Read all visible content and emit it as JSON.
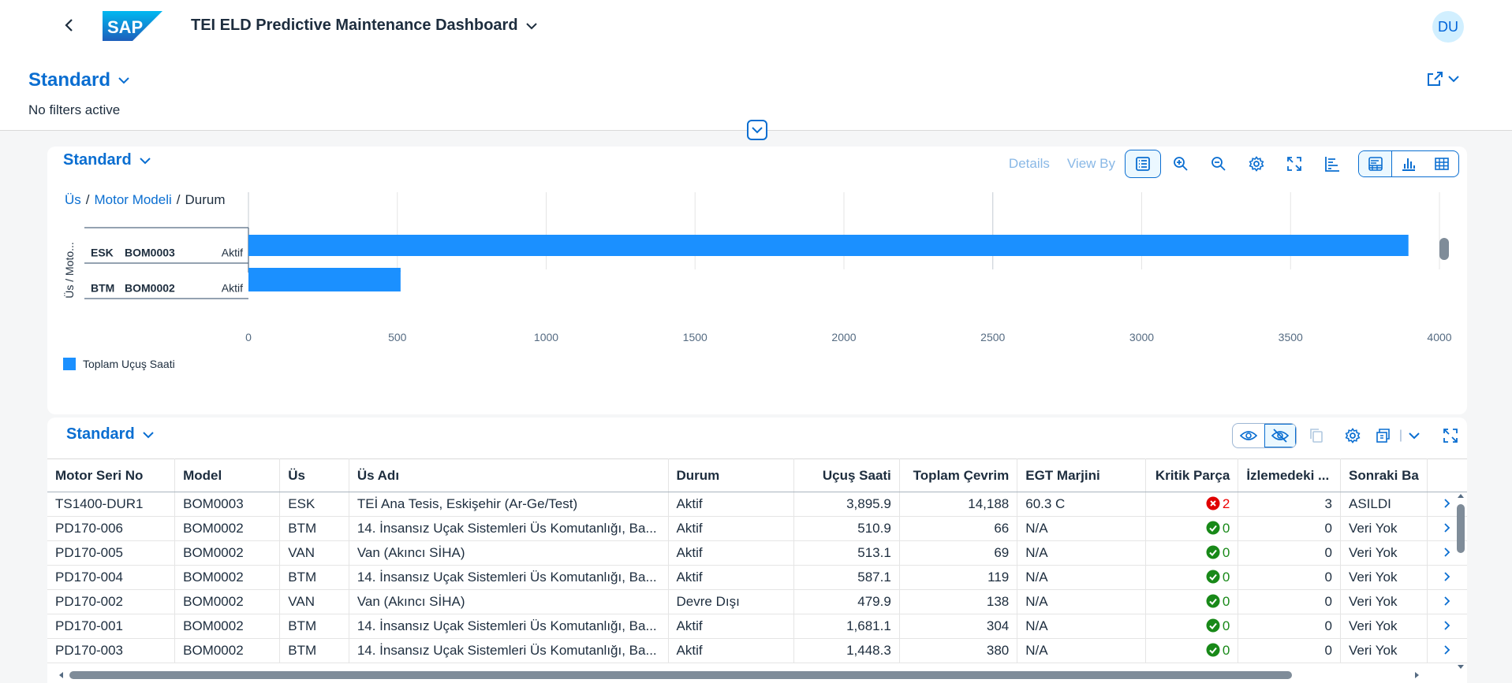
{
  "shell": {
    "title": "TEI ELD Predictive Maintenance Dashboard",
    "logo_text": "SAP",
    "avatar": "DU"
  },
  "header": {
    "variant": "Standard",
    "filters_status": "No filters active"
  },
  "chart_card": {
    "variant": "Standard",
    "toolbar": {
      "details": "Details",
      "view_by": "View By"
    },
    "breadcrumb": [
      "Üs",
      "Motor Modeli",
      "Durum"
    ],
    "y_axis_label": "Üs / Moto..."
  },
  "chart_data": {
    "type": "bar",
    "orientation": "horizontal",
    "categories": [
      {
        "base": "ESK",
        "model": "BOM0003",
        "status": "Aktif"
      },
      {
        "base": "BTM",
        "model": "BOM0002",
        "status": "Aktif"
      }
    ],
    "series": [
      {
        "name": "Toplam Uçuş Saati",
        "values": [
          3895.9,
          510.9
        ],
        "color": "#1b90ff"
      }
    ],
    "x_ticks": [
      "0",
      "500",
      "1000",
      "1500",
      "2000",
      "2500",
      "3000",
      "3500",
      "4000"
    ],
    "xlim": [
      0,
      4000
    ],
    "legend": "Toplam Uçuş Saati",
    "legend_position": "bottom-left",
    "grid": true
  },
  "table_card": {
    "variant": "Standard",
    "columns": [
      "Motor Seri No",
      "Model",
      "Üs",
      "Üs Adı",
      "Durum",
      "Uçuş Saati",
      "Toplam Çevrim",
      "EGT Marjini",
      "Kritik Parça",
      "İzlemedeki ...",
      "Sonraki Ba"
    ],
    "rows": [
      {
        "serial": "TS1400-DUR1",
        "model": "BOM0003",
        "base": "ESK",
        "base_name": "TEİ Ana Tesis, Eskişehir (Ar-Ge/Test)",
        "status": "Aktif",
        "hours": "3,895.9",
        "cycles": "14,188",
        "egt": "60.3 C",
        "critical": "2",
        "critical_state": "error",
        "monitoring": "3",
        "next": "ASILDI"
      },
      {
        "serial": "PD170-006",
        "model": "BOM0002",
        "base": "BTM",
        "base_name": "14. İnsansız Uçak Sistemleri Üs Komutanlığı, Ba...",
        "status": "Aktif",
        "hours": "510.9",
        "cycles": "66",
        "egt": "N/A",
        "critical": "0",
        "critical_state": "ok",
        "monitoring": "0",
        "next": "Veri Yok"
      },
      {
        "serial": "PD170-005",
        "model": "BOM0002",
        "base": "VAN",
        "base_name": "Van (Akıncı SİHA)",
        "status": "Aktif",
        "hours": "513.1",
        "cycles": "69",
        "egt": "N/A",
        "critical": "0",
        "critical_state": "ok",
        "monitoring": "0",
        "next": "Veri Yok"
      },
      {
        "serial": "PD170-004",
        "model": "BOM0002",
        "base": "BTM",
        "base_name": "14. İnsansız Uçak Sistemleri Üs Komutanlığı, Ba...",
        "status": "Aktif",
        "hours": "587.1",
        "cycles": "119",
        "egt": "N/A",
        "critical": "0",
        "critical_state": "ok",
        "monitoring": "0",
        "next": "Veri Yok"
      },
      {
        "serial": "PD170-002",
        "model": "BOM0002",
        "base": "VAN",
        "base_name": "Van (Akıncı SİHA)",
        "status": "Devre Dışı",
        "hours": "479.9",
        "cycles": "138",
        "egt": "N/A",
        "critical": "0",
        "critical_state": "ok",
        "monitoring": "0",
        "next": "Veri Yok"
      },
      {
        "serial": "PD170-001",
        "model": "BOM0002",
        "base": "BTM",
        "base_name": "14. İnsansız Uçak Sistemleri Üs Komutanlığı, Ba...",
        "status": "Aktif",
        "hours": "1,681.1",
        "cycles": "304",
        "egt": "N/A",
        "critical": "0",
        "critical_state": "ok",
        "monitoring": "0",
        "next": "Veri Yok"
      },
      {
        "serial": "PD170-003",
        "model": "BOM0002",
        "base": "BTM",
        "base_name": "14. İnsansız Uçak Sistemleri Üs Komutanlığı, Ba...",
        "status": "Aktif",
        "hours": "1,448.3",
        "cycles": "380",
        "egt": "N/A",
        "critical": "0",
        "critical_state": "ok",
        "monitoring": "0",
        "next": "Veri Yok"
      }
    ]
  },
  "colors": {
    "brand": "#0a6ed1",
    "bar": "#1b90ff",
    "ok": "#188918",
    "error": "#e00000"
  }
}
